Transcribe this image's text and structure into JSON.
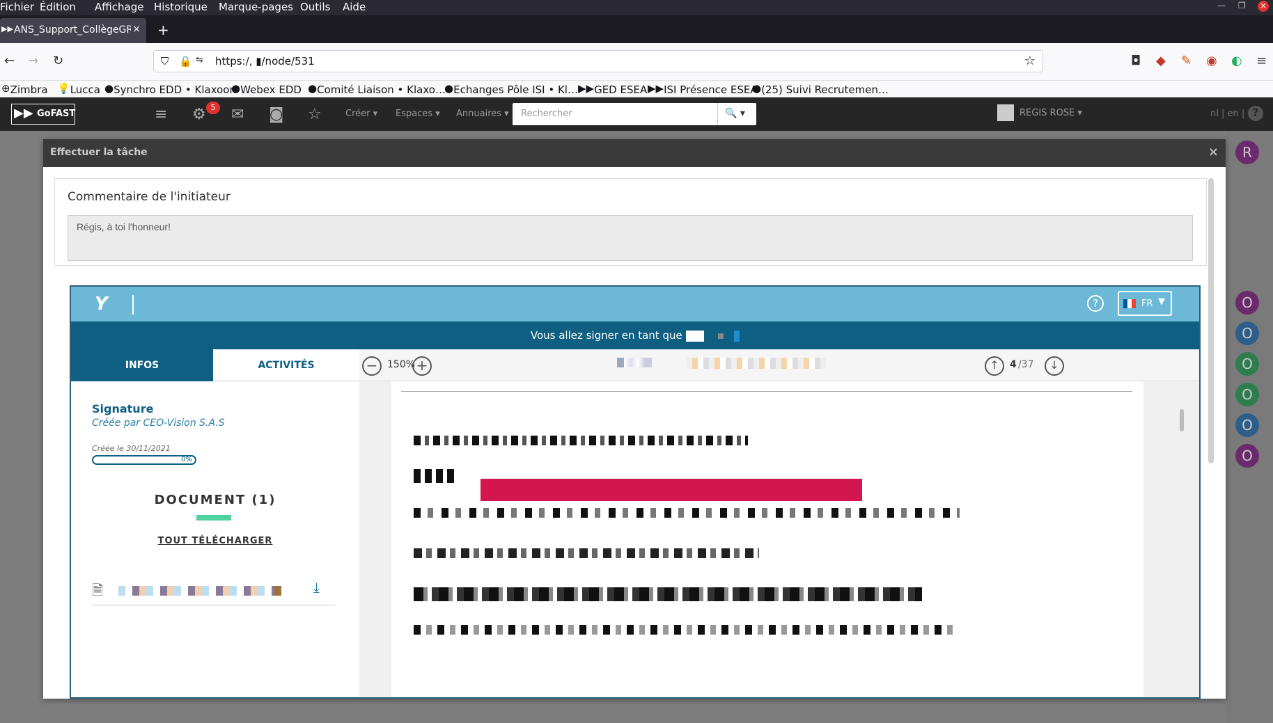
{
  "menubar": {
    "items": [
      "Fichier",
      "Édition",
      "Affichage",
      "Historique",
      "Marque-pages",
      "Outils",
      "Aide"
    ]
  },
  "browser_tab": {
    "title": "ANS_Support_CollègeGR",
    "close": "×",
    "new": "+"
  },
  "url": {
    "text": "https:/,           ▮/node/531"
  },
  "bookmarks": [
    "Zimbra",
    "Lucca",
    "Synchro EDD • Klaxoon",
    "Webex EDD",
    "Comité Liaison • Klaxo…",
    "Echanges Pôle ISI • Kl…",
    "GED ESEA",
    "ISI Présence ESEA",
    "(25) Suivi Recrutemen…"
  ],
  "gofast": {
    "logo": "GoFAST",
    "badge": "5",
    "menus": [
      "Créer ▾",
      "Espaces ▾",
      "Annuaires ▾"
    ],
    "search_placeholder": "Rechercher",
    "user": "REGIS ROSE ▾",
    "langs": "nl | en | fr",
    "help": "?"
  },
  "modal": {
    "title": "Effectuer la tâche",
    "close": "×",
    "comment_heading": "Commentaire de l'initiateur",
    "comment_text": "Régis, à toi l'honneur!"
  },
  "signer": {
    "help": "?",
    "lang": "FR",
    "banner": "Vous allez signer en tant que",
    "tab_infos": "INFOS",
    "tab_activities": "ACTIVITÉS",
    "zoom": "150%",
    "page_current": "4",
    "page_total": "/37",
    "signature_title": "Signature",
    "created_by": "Créée par CEO-Vision S.A.S",
    "created_date": "Créée le 30/11/2021",
    "progress": "0%",
    "document_heading": "DOCUMENT (1)",
    "download_all": "TOUT TÉLÉCHARGER"
  },
  "right_sidebar": {
    "avatars": [
      "R",
      "O",
      "O",
      "O",
      "O",
      "O",
      "O"
    ]
  }
}
